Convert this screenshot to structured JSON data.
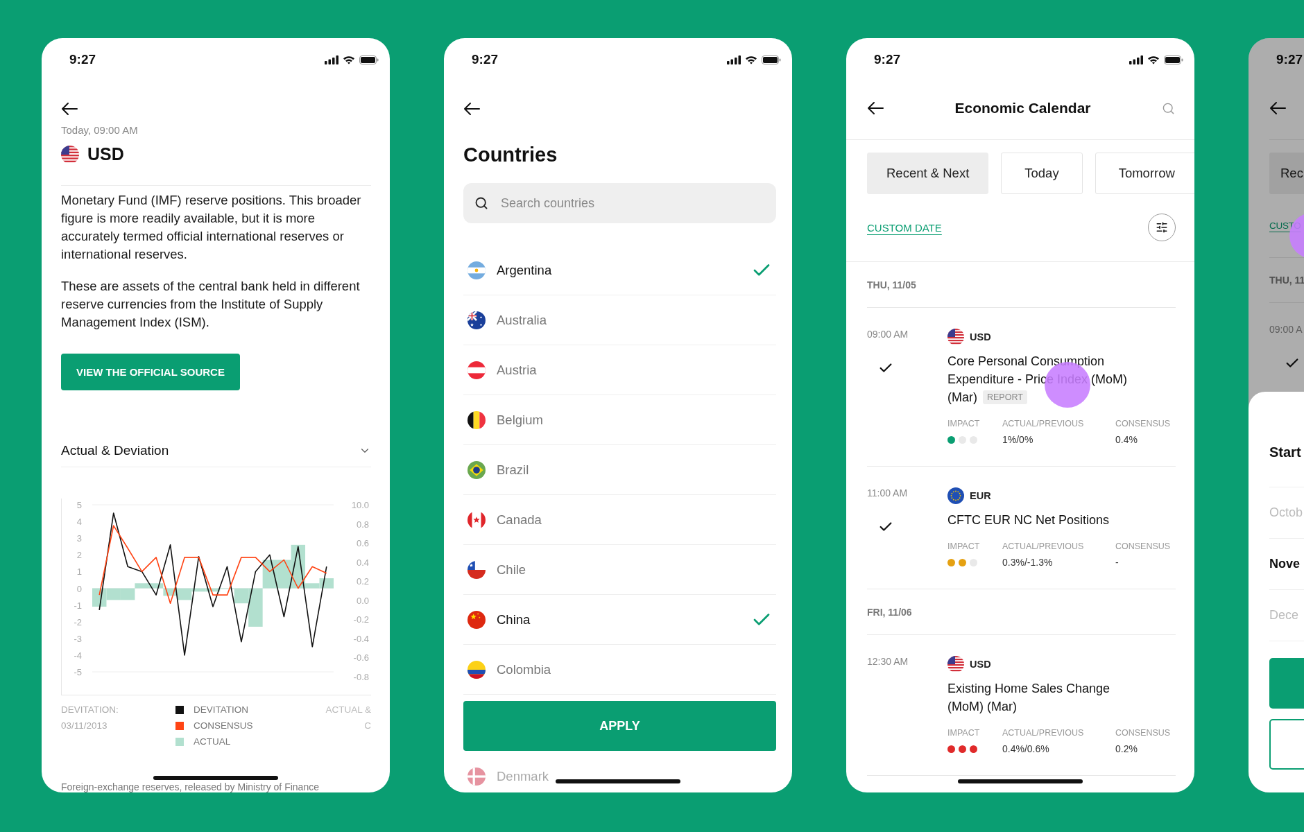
{
  "event_detail": {
    "status_bar": {
      "time": "9:27"
    },
    "datetime": "Today, 09:00 AM",
    "currency": "USD",
    "paragraphs": [
      "Monetary Fund (IMF) reserve positions. This broader figure is more readily available, but it is more accurately termed official international reserves or international reserves.",
      "These are assets of the central bank held in different reserve currencies from the Institute of Supply Management Index (ISM)."
    ],
    "source_button": "VIEW THE OFFICIAL SOURCE",
    "section": {
      "title": "Actual & Deviation",
      "expanded": true,
      "right_axis_labels": [
        "10.0",
        "0.8",
        "0.6",
        "0.4",
        "0.2",
        "0.0",
        "-0.2",
        "-0.4",
        "-0.6",
        "-0.8"
      ],
      "chart_data": {
        "type": "line",
        "ylim": [
          -5,
          5
        ],
        "yticks": [
          5,
          4,
          3,
          2,
          1,
          0,
          -1,
          -2,
          -3,
          -4,
          -5
        ],
        "series": [
          {
            "name": "DEVITATION",
            "color": "#111111",
            "values": [
              -1.3,
              4.5,
              1.3,
              1.0,
              -0.4,
              2.6,
              -4.0,
              1.9,
              -1.1,
              1.3,
              -3.2,
              1.0,
              2.0,
              -1.7,
              2.5,
              -3.5,
              1.3
            ]
          },
          {
            "name": "CONSENSUS",
            "color": "#ff4414",
            "values": [
              -0.4,
              3.75,
              2.4,
              1.0,
              1.85,
              -0.9,
              1.85,
              1.85,
              -0.4,
              -0.4,
              1.85,
              1.85,
              1.0,
              1.7,
              0,
              1.3,
              0.9
            ]
          },
          {
            "name": "ACTUAL",
            "type": "bar",
            "color": "#b2e0cf",
            "values": [
              -1.1,
              -0.7,
              -0.7,
              0.3,
              0.3,
              -0.45,
              -0.7,
              -0.2,
              -0.2,
              0,
              -0.9,
              -2.3,
              1.7,
              1.7,
              2.6,
              0.3,
              0.6
            ]
          }
        ]
      }
    },
    "summary": {
      "label": "DEVITATION:",
      "date": "03/11/2013",
      "right_lines": [
        "ACTUAL &",
        "C"
      ]
    },
    "footer_text": "Foreign-exchange reserves, released by Ministry of Finance"
  },
  "countries_screen": {
    "status_bar": {
      "time": "9:27"
    },
    "title": "Countries",
    "search": {
      "placeholder": "Search countries"
    },
    "countries": [
      {
        "name": "Argentina",
        "selected": true
      },
      {
        "name": "Australia",
        "selected": false
      },
      {
        "name": "Austria",
        "selected": false
      },
      {
        "name": "Belgium",
        "selected": false
      },
      {
        "name": "Brazil",
        "selected": false
      },
      {
        "name": "Canada",
        "selected": false
      },
      {
        "name": "Chile",
        "selected": false
      },
      {
        "name": "China",
        "selected": true
      },
      {
        "name": "Colombia",
        "selected": false
      }
    ],
    "apply_button": "APPLY",
    "peek_row": {
      "name": "Denmark"
    }
  },
  "calendar_screen": {
    "status_bar": {
      "time": "9:27"
    },
    "title": "Economic Calendar",
    "tabs": [
      {
        "label": "Recent & Next",
        "selected": true
      },
      {
        "label": "Today",
        "selected": false
      },
      {
        "label": "Tomorrow",
        "selected": false
      }
    ],
    "custom_date_link": "CUSTOM DATE",
    "days": [
      {
        "date": "THU, 11/05",
        "events": [
          {
            "time": "09:00 AM",
            "done": true,
            "currency": "USD",
            "title": "Core Personal Consumption Expenditure - Price Index (MoM) (Mar)",
            "badge": "REPORT",
            "impact_label": "IMPACT",
            "stars": 1,
            "color": "#0a9e72",
            "actual_label": "ACTUAL/PREVIOUS",
            "actual_previous": "1%/0%",
            "consensus_label": "CONSENSUS",
            "consensus": "0.4%"
          },
          {
            "time": "11:00 AM",
            "done": true,
            "currency": "EUR",
            "title": "CFTC EUR NC Net Positions",
            "impact_label": "IMPACT",
            "stars": 2,
            "color": "#e5a112",
            "actual_label": "ACTUAL/PREVIOUS",
            "actual_previous": "0.3%/-1.3%",
            "consensus_label": "CONSENSUS",
            "consensus": "-"
          }
        ]
      },
      {
        "date": "FRI, 11/06",
        "events": [
          {
            "time": "12:30 AM",
            "done": false,
            "currency": "USD",
            "title": "Existing Home Sales Change (MoM) (Mar)",
            "impact_label": "IMPACT",
            "stars": 3,
            "color": "#e02a2a",
            "actual_label": "ACTUAL/PREVIOUS",
            "actual_previous": "0.4%/0.6%",
            "consensus_label": "CONSENSUS",
            "consensus": "0.2%"
          }
        ]
      }
    ],
    "touch_indicator": true
  },
  "calendar_with_sheet": {
    "status_bar": {
      "time": "9:27"
    },
    "tab": "Rec",
    "link": "CUSTO",
    "date": "THU, 11",
    "event_time": "09:00 A",
    "event_done": true,
    "touch_indicator": true,
    "sheet": {
      "title": "Start",
      "months": [
        {
          "label": "Octob",
          "selected": false
        },
        {
          "label": "Nove",
          "selected": true
        },
        {
          "label": "Dece",
          "selected": false
        }
      ]
    }
  }
}
